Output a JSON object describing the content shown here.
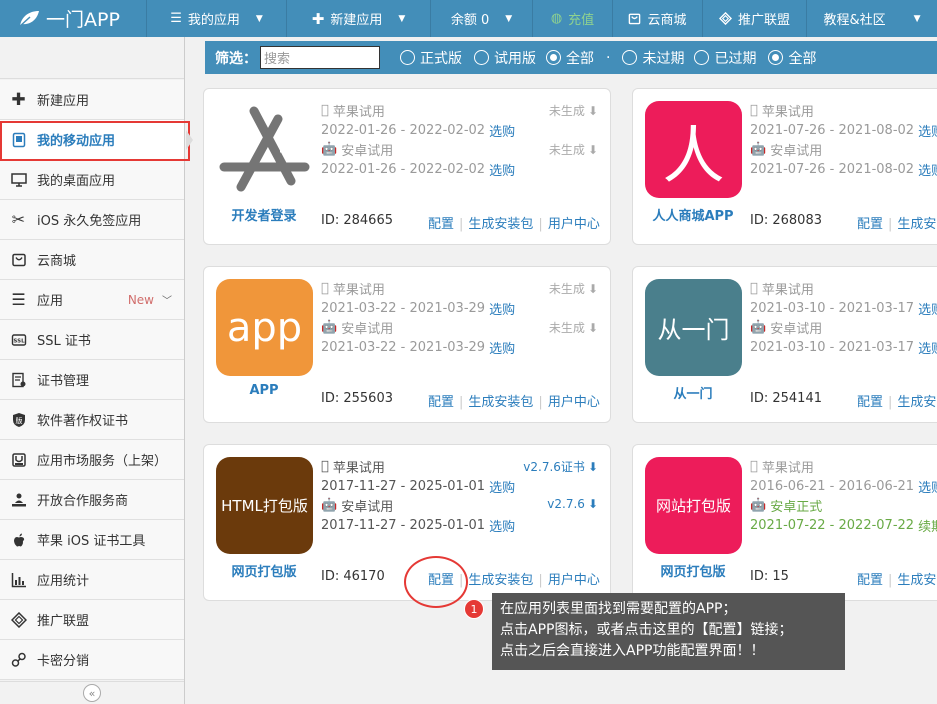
{
  "topbar": {
    "logo": "一门APP",
    "nav": [
      {
        "label": "我的应用",
        "icon": "list-icon"
      },
      {
        "label": "新建应用",
        "icon": "plus-icon"
      },
      {
        "label": "余额 0",
        "icon": ""
      },
      {
        "label": "充值",
        "icon": "recharge-icon"
      },
      {
        "label": "云商城",
        "icon": "store-icon"
      },
      {
        "label": "推广联盟",
        "icon": "diamond-icon"
      },
      {
        "label": "教程&社区",
        "icon": ""
      }
    ]
  },
  "sidebar": {
    "items": [
      {
        "label": "新建应用",
        "icon": "plus-icon"
      },
      {
        "label": "我的移动应用",
        "icon": "tablet-icon"
      },
      {
        "label": "我的桌面应用",
        "icon": "monitor-icon"
      },
      {
        "label": "iOS 永久免签应用",
        "icon": "scissors-icon"
      },
      {
        "label": "云商城",
        "icon": "store-icon"
      },
      {
        "label": "应用",
        "icon": "menu-icon",
        "badge": "New"
      },
      {
        "label": "SSL 证书",
        "icon": "ssl-icon"
      },
      {
        "label": "证书管理",
        "icon": "certificate-icon"
      },
      {
        "label": "软件著作权证书",
        "icon": "copyright-icon"
      },
      {
        "label": "应用市场服务（上架）",
        "icon": "market-icon"
      },
      {
        "label": "开放合作服务商",
        "icon": "partner-icon"
      },
      {
        "label": "苹果 iOS 证书工具",
        "icon": "apple-icon"
      },
      {
        "label": "应用统计",
        "icon": "stats-icon"
      },
      {
        "label": "推广联盟",
        "icon": "diamond-icon"
      },
      {
        "label": "卡密分销",
        "icon": "key-icon"
      }
    ],
    "collapse": "«"
  },
  "filter": {
    "label": "筛选：",
    "placeholder": "搜索",
    "group1": [
      "正式版",
      "试用版",
      "全部"
    ],
    "sep": "·",
    "group2": [
      "未过期",
      "已过期",
      "全部"
    ]
  },
  "cards": [
    {
      "name": "开发者登录",
      "id": "ID: 284665",
      "ios": "苹果试用",
      "ios_dates": "2022-01-26 - 2022-02-02",
      "ios_buy": "选购",
      "ios_status": "未生成",
      "android": "安卓试用",
      "android_dates": "2022-01-26 - 2022-02-02",
      "android_buy": "选购",
      "android_status": "未生成"
    },
    {
      "name": "人人商城APP",
      "icon_text": "人",
      "id": "ID: 268083",
      "ios": "苹果试用",
      "ios_dates": "2021-07-26 - 2021-08-02",
      "ios_buy": "选购",
      "android": "安卓试用",
      "android_dates": "2021-07-26 - 2021-08-02",
      "android_buy": "选购"
    },
    {
      "name": "APP",
      "icon_text": "app",
      "id": "ID: 255603",
      "ios": "苹果试用",
      "ios_dates": "2021-03-22 - 2021-03-29",
      "ios_buy": "选购",
      "ios_status": "未生成",
      "android": "安卓试用",
      "android_dates": "2021-03-22 - 2021-03-29",
      "android_buy": "选购",
      "android_status": "未生成"
    },
    {
      "name": "从一门",
      "icon_text": "从一门",
      "id": "ID: 254141",
      "ios": "苹果试用",
      "ios_dates": "2021-03-10 - 2021-03-17",
      "ios_buy": "选购",
      "android": "安卓试用",
      "android_dates": "2021-03-10 - 2021-03-17",
      "android_buy": "选购"
    },
    {
      "name": "网页打包版",
      "icon_text": "HTML打包版",
      "id": "ID: 46170",
      "ios": "苹果试用",
      "ios_dates": "2017-11-27 - 2025-01-01",
      "ios_buy": "选购",
      "ios_status": "v2.7.6证书",
      "android": "安卓试用",
      "android_dates": "2017-11-27 - 2025-01-01",
      "android_buy": "选购",
      "android_status": "v2.7.6"
    },
    {
      "name": "网页打包版",
      "icon_text": "网站打包版",
      "id": "ID: 15",
      "ios": "苹果试用",
      "ios_dates": "2016-06-21 - 2016-06-21",
      "ios_buy": "选购",
      "android": "安卓正式",
      "android_dates": "2021-07-22 - 2022-07-22",
      "android_buy": "续期"
    }
  ],
  "actions": {
    "config": "配置",
    "package": "生成安装包",
    "user_center": "用户中心",
    "package_short": "生成安"
  },
  "tooltip": {
    "badge": "1",
    "line1": "在应用列表里面找到需要配置的APP；",
    "line2": "点击APP图标，或者点击这里的【配置】链接；",
    "line3": "点击之后会直接进入APP功能配置界面！！"
  }
}
